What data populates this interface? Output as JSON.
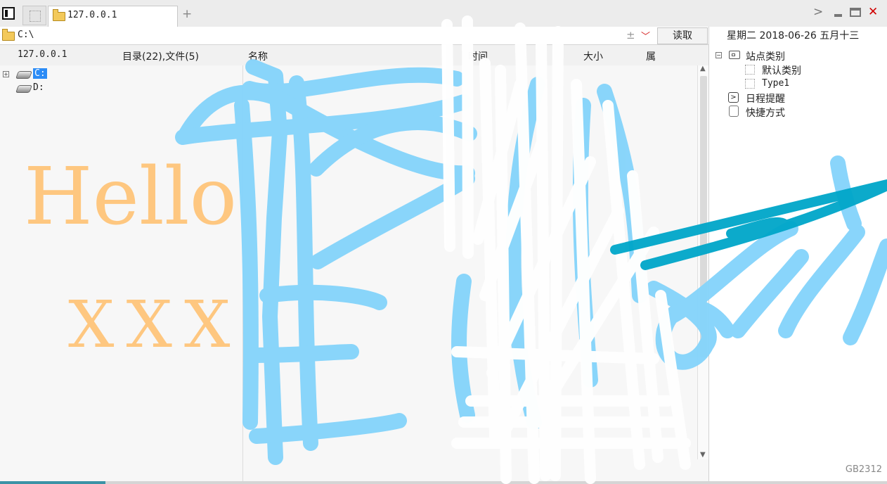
{
  "tabs": [
    {
      "title": "127.0.0.1"
    }
  ],
  "address": {
    "path": "C:\\",
    "plus": "±",
    "read_button": "读取"
  },
  "left_header": {
    "host": "127.0.0.1",
    "counts": "目录(22),文件(5)"
  },
  "columns": [
    "名称",
    "时间",
    "大小",
    "属"
  ],
  "drives": [
    {
      "label": "C:"
    },
    {
      "label": "D:"
    }
  ],
  "right_panel": {
    "date": "星期二 2018-06-26 五月十三",
    "tree": [
      {
        "label": "站点类别"
      },
      {
        "label": "默认类别"
      },
      {
        "label": "Type1"
      },
      {
        "label": "日程提醒"
      },
      {
        "label": "快捷方式"
      }
    ]
  },
  "status": {
    "encoding": "GB2312"
  },
  "annotations": {
    "hello": "Hello",
    "xxx": "XXX"
  },
  "colors": {
    "selection": "#2c8cf6",
    "close": "#d00000",
    "annotation_orange": "#ffc57a",
    "annotation_blue": "#86d4fb",
    "annotation_dark": "#00a6c9"
  }
}
